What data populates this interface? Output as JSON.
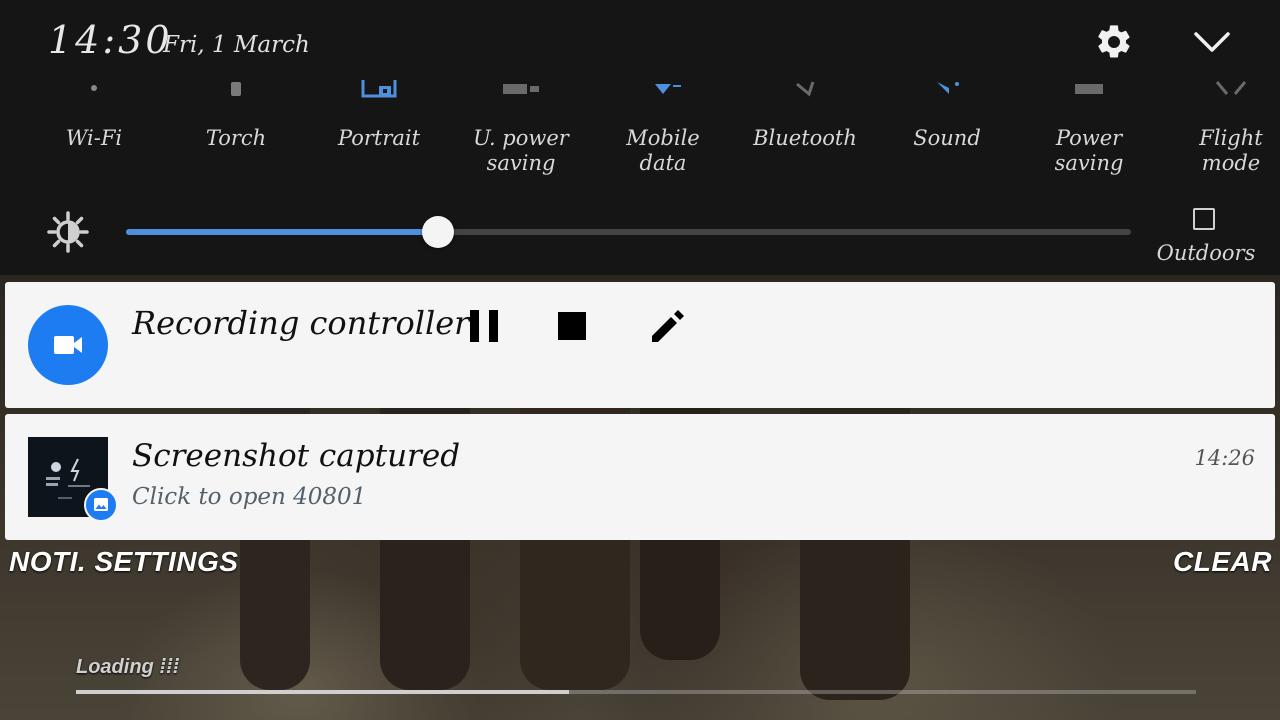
{
  "status": {
    "time": "14:30",
    "date": "Fri, 1 March"
  },
  "quick_toggles": [
    {
      "label": "Wi-Fi",
      "icon": "wifi-icon"
    },
    {
      "label": "Torch",
      "icon": "torch-icon"
    },
    {
      "label": "Portrait",
      "icon": "portrait-lock-icon"
    },
    {
      "label": "U. power\nsaving",
      "icon": "ultra-power-saving-icon"
    },
    {
      "label": "Mobile\ndata",
      "icon": "mobile-data-icon"
    },
    {
      "label": "Bluetooth",
      "icon": "bluetooth-icon"
    },
    {
      "label": "Sound",
      "icon": "sound-icon"
    },
    {
      "label": "Power\nsaving",
      "icon": "power-saving-icon"
    },
    {
      "label": "Flight\nmode",
      "icon": "flight-mode-icon"
    }
  ],
  "brightness": {
    "level": 0.31,
    "outdoors_label": "Outdoors",
    "outdoors_checked": false
  },
  "notifications": {
    "recording": {
      "title": "Recording controller",
      "buttons": [
        "pause-icon",
        "stop-icon",
        "edit-icon"
      ]
    },
    "screenshot": {
      "title": "Screenshot captured",
      "subtitle": "Click to open 40801",
      "time": "14:26"
    }
  },
  "footer": {
    "settings_label": "NOTI. SETTINGS",
    "clear_label": "CLEAR"
  },
  "background": {
    "loading_text": "Loading",
    "loading_progress": 0.44
  },
  "colors": {
    "accent": "#1e7cf2",
    "slider": "#4f8fe0",
    "panel": "#151515",
    "card": "#f5f5f5"
  }
}
